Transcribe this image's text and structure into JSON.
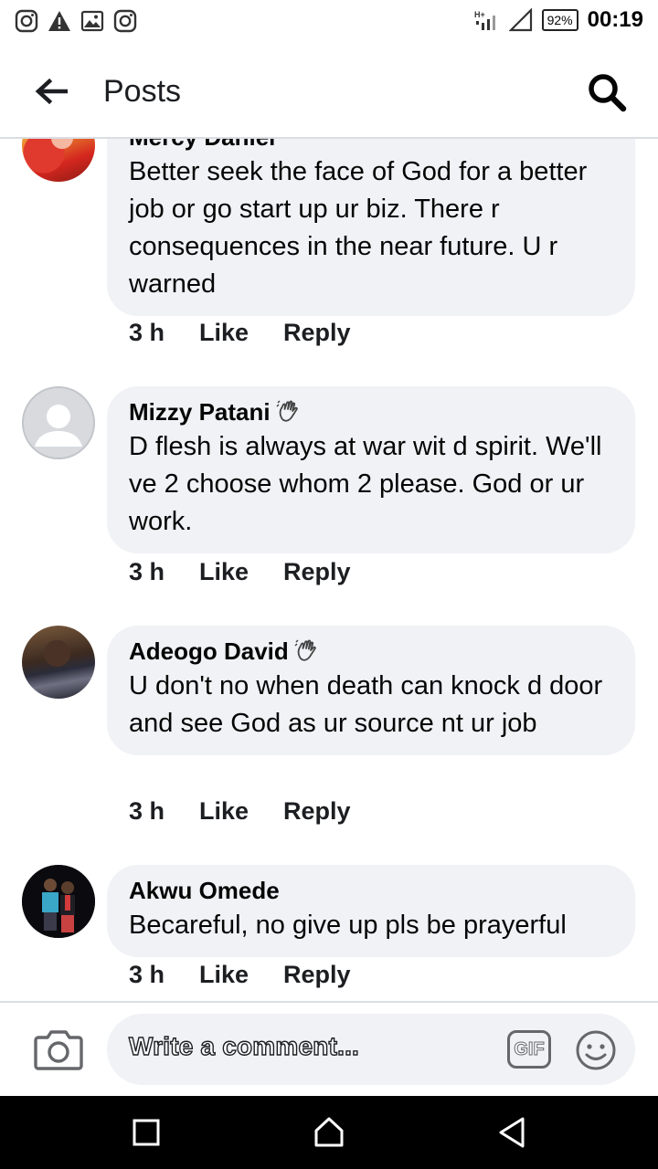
{
  "status_bar": {
    "battery": "92%",
    "time": "00:19",
    "left_icons": [
      "instagram-icon",
      "warning-icon",
      "image-icon",
      "instagram-icon"
    ],
    "right_icons": [
      "network-icon",
      "signal-icon",
      "battery-icon"
    ]
  },
  "header": {
    "title": "Posts",
    "back_icon": "arrow-left-icon",
    "search_icon": "search-icon"
  },
  "comments": [
    {
      "author": "Mercy Daniel",
      "text": "Better seek the face of God for a better job or go start up ur biz. There r consequences in the near future. U r warned",
      "time": "3 h",
      "like": "Like",
      "reply": "Reply",
      "badge": false
    },
    {
      "author": "Mizzy Patani",
      "text": "D flesh is always at war wit d spirit. We'll ve 2 choose whom 2 please. God or ur work.",
      "time": "3 h",
      "like": "Like",
      "reply": "Reply",
      "badge": true
    },
    {
      "author": "Adeogo David",
      "text": "U don't no when death can knock d door and see God as ur source nt ur job",
      "time": "3 h",
      "like": "Like",
      "reply": "Reply",
      "badge": true
    },
    {
      "author": "Akwu Omede",
      "text": "Becareful, no give up pls be prayerful",
      "time": "3 h",
      "like": "Like",
      "reply": "Reply",
      "badge": false
    }
  ],
  "composer": {
    "placeholder": "Write a comment...",
    "gif_label": "GIF",
    "camera_icon": "camera-icon",
    "emoji_icon": "emoji-icon"
  },
  "nav_bar": {
    "icons": [
      "recents-icon",
      "home-icon",
      "back-triangle-icon"
    ]
  },
  "colors": {
    "bubble": "#f0f2f5",
    "text": "#050505",
    "icon_gray": "#65676b",
    "nav_bg": "#000000"
  }
}
